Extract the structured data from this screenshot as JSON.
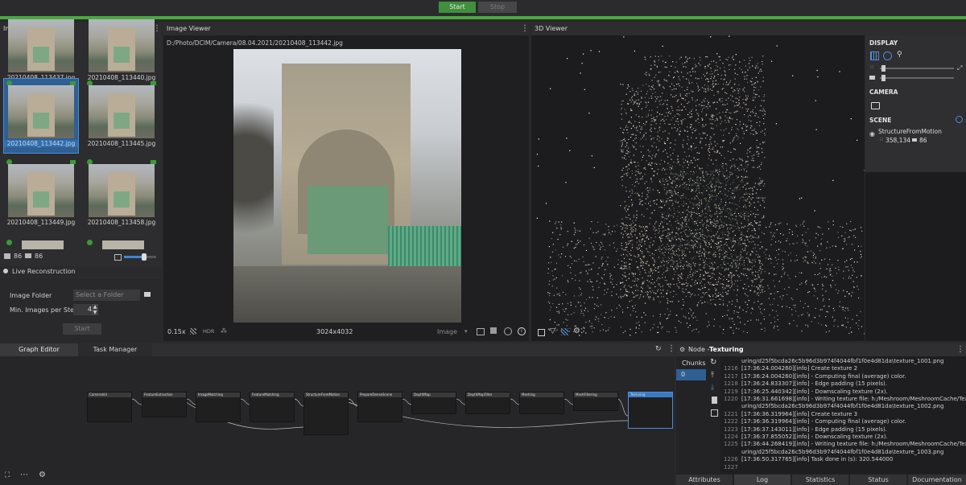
{
  "toolbar": {
    "start_label": "Start",
    "stop_label": "Stop"
  },
  "images_panel": {
    "title": "Images",
    "thumbnails": [
      {
        "name": "20210408_113437.jpg"
      },
      {
        "name": "20210408_113440.jpg"
      },
      {
        "name": "20210408_113442.jpg",
        "selected": true
      },
      {
        "name": "20210408_113445.jpg"
      },
      {
        "name": "20210408_113449.jpg"
      },
      {
        "name": "20210408_113458.jpg"
      }
    ],
    "image_count": "86",
    "camera_count": "86",
    "live_reconstruction": "Live Reconstruction",
    "image_folder_label": "Image Folder",
    "image_folder_placeholder": "Select a Folder",
    "min_images_label": "Min. Images per Step",
    "min_images_value": "4",
    "start_label": "Start"
  },
  "image_viewer": {
    "title": "Image Viewer",
    "path": "D:/Photo/DCIM/Camera/08.04.2021/20210408_113442.jpg",
    "zoom": "0.15x",
    "hdr": "HDR",
    "resolution": "3024x4032",
    "mode": "Image"
  },
  "viewer_3d": {
    "title": "3D Viewer",
    "display_title": "DISPLAY",
    "camera_title": "CAMERA",
    "scene_title": "SCENE",
    "scene_item": "StructureFromMotion",
    "points_count": "358,134",
    "cameras_count": "86"
  },
  "bottom": {
    "tabs": [
      "Graph Editor",
      "Task Manager"
    ],
    "node_label": "Node - ",
    "node_name": "Texturing",
    "chunks_label": "Chunks",
    "chunk_value": "0",
    "nodes": [
      "CameraInit",
      "FeatureExtraction",
      "ImageMatching",
      "FeatureMatching",
      "StructureFromMotion",
      "PrepareDenseScene",
      "DepthMap",
      "DepthMapFilter",
      "Meshing",
      "MeshFiltering",
      "Texturing"
    ],
    "log_lines": [
      {
        "n": "",
        "t": "uring/d25f5bcda26c5b96d3b974f4044fbf1f0e4d81da\\texture_1001.png"
      },
      {
        "n": "1216",
        "t": "[17:36:24.004260][info] Create texture 2"
      },
      {
        "n": "1217",
        "t": "[17:36:24.004260][info]  - Computing final (average) color."
      },
      {
        "n": "1218",
        "t": "[17:36:24.833307][info]  - Edge padding (15 pixels)."
      },
      {
        "n": "1219",
        "t": "[17:36:25.440342][info]  - Downscaling texture (2x)."
      },
      {
        "n": "1220",
        "t": "[17:36:31.661698][info]  - Writing texture file: h:/Meshroom/MeshroomCache/Text"
      },
      {
        "n": "",
        "t": "uring/d25f5bcda26c5b96d3b974f4044fbf1f0e4d81da\\texture_1002.png"
      },
      {
        "n": "1221",
        "t": "[17:36:36.319964][info] Create texture 3"
      },
      {
        "n": "1222",
        "t": "[17:36:36.319964][info]  - Computing final (average) color."
      },
      {
        "n": "1223",
        "t": "[17:36:37.143011][info]  - Edge padding (15 pixels)."
      },
      {
        "n": "1224",
        "t": "[17:36:37.855052][info]  - Downscaling texture (2x)."
      },
      {
        "n": "1225",
        "t": "[17:36:44.268419][info]  - Writing texture file: h:/Meshroom/MeshroomCache/Text"
      },
      {
        "n": "",
        "t": "uring/d25f5bcda26c5b96d3b974f4044fbf1f0e4d81da\\texture_1003.png"
      },
      {
        "n": "1226",
        "t": "[17:36:50.317765][info] Task done in (s): 320.544000"
      },
      {
        "n": "1227",
        "t": ""
      }
    ],
    "node_tabs": [
      "Attributes",
      "Log",
      "Statistics",
      "Status",
      "Documentation"
    ]
  },
  "colors": {
    "accent_green": "#4aa83f",
    "selection_blue": "#2f6fb3"
  },
  "icons": [
    "kebab-menu-icon",
    "image-icon",
    "camera-icon",
    "folder-icon",
    "refresh-icon",
    "grid-icon",
    "eye-icon",
    "gear-icon"
  ]
}
